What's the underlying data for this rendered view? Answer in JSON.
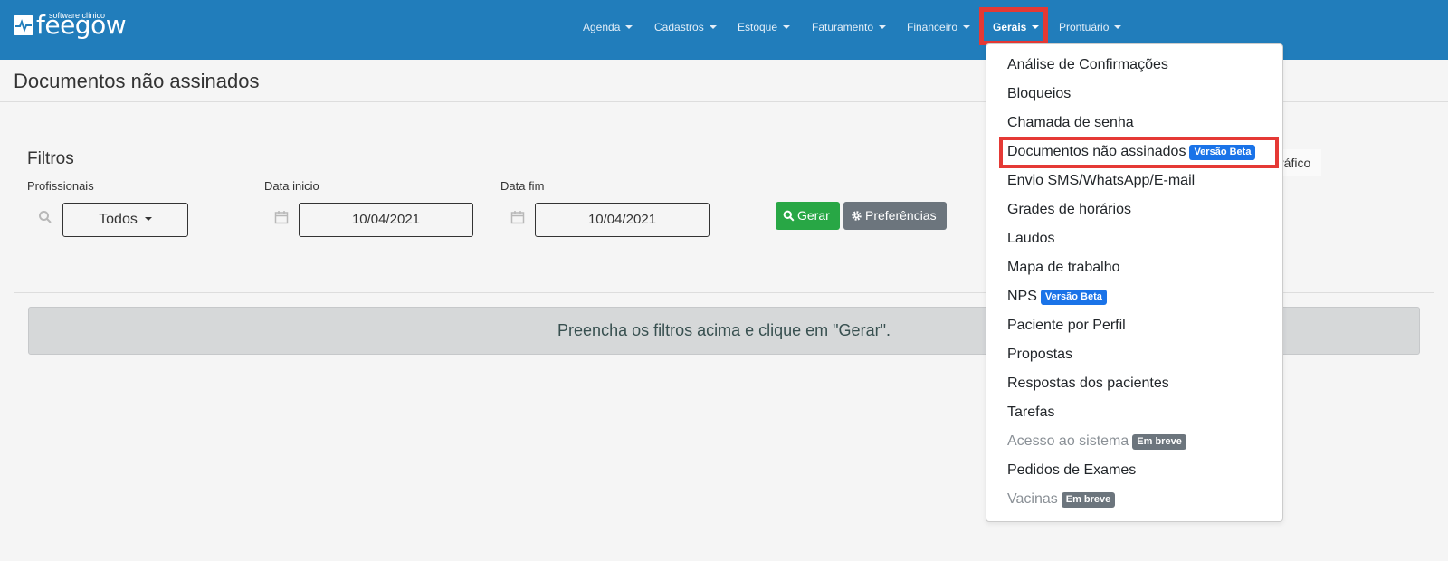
{
  "brand": {
    "small_text": "software clínico",
    "name": "feegow"
  },
  "nav": {
    "items": [
      {
        "label": "Agenda"
      },
      {
        "label": "Cadastros"
      },
      {
        "label": "Estoque"
      },
      {
        "label": "Faturamento"
      },
      {
        "label": "Financeiro"
      },
      {
        "label": "Gerais"
      },
      {
        "label": "Prontuário"
      }
    ],
    "active": "Gerais"
  },
  "page": {
    "title": "Documentos não assinados"
  },
  "filters": {
    "title": "Filtros",
    "profissionais_label": "Profissionais",
    "profissionais_value": "Todos",
    "data_inicio_label": "Data inicio",
    "data_inicio_value": "10/04/2021",
    "data_fim_label": "Data fim",
    "data_fim_value": "10/04/2021",
    "gerar_label": "Gerar",
    "preferencias_label": "Preferências",
    "grafico_fragment": "ráfico"
  },
  "alert": {
    "message": "Preencha os filtros acima e clique em \"Gerar\"."
  },
  "dropdown": {
    "items": [
      {
        "label": "Análise de Confirmações"
      },
      {
        "label": "Bloqueios"
      },
      {
        "label": "Chamada de senha"
      },
      {
        "label": "Documentos não assinados",
        "badge": "Versão Beta"
      },
      {
        "label": "Envio SMS/WhatsApp/E-mail"
      },
      {
        "label": "Grades de horários"
      },
      {
        "label": "Laudos"
      },
      {
        "label": "Mapa de trabalho"
      },
      {
        "label": "NPS",
        "badge": "Versão Beta"
      },
      {
        "label": "Paciente por Perfil"
      },
      {
        "label": "Propostas"
      },
      {
        "label": "Respostas dos pacientes"
      },
      {
        "label": "Tarefas"
      },
      {
        "label": "Acesso ao sistema",
        "badge": "Em breve"
      },
      {
        "label": "Pedidos de Exames"
      },
      {
        "label": "Vacinas",
        "badge": "Em breve"
      }
    ]
  },
  "colors": {
    "topbar": "#217dbb",
    "highlight": "#e53935",
    "badge_beta": "#1a73e8",
    "badge_soon": "#6c757d",
    "button_green": "#28a745",
    "button_gray": "#6c757d"
  }
}
